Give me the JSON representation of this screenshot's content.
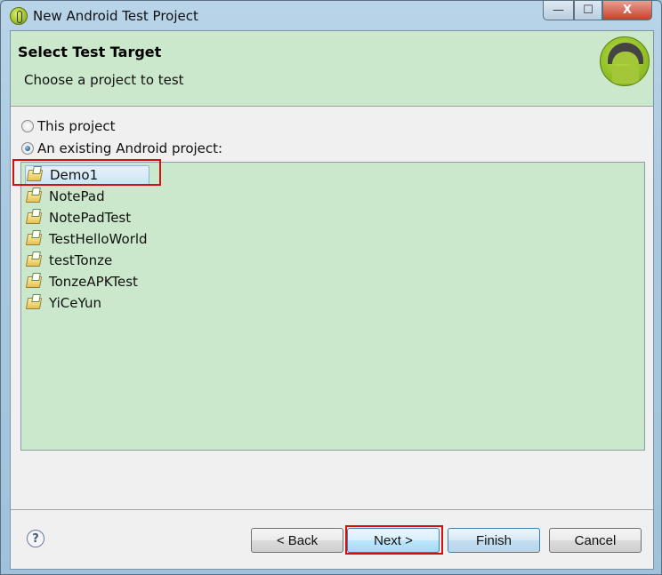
{
  "window": {
    "title": "New Android Test Project",
    "controls": {
      "minimize": "—",
      "maximize": "☐",
      "close": "X"
    }
  },
  "header": {
    "title": "Select Test Target",
    "description": "Choose a project to test"
  },
  "options": {
    "this_project": {
      "label": "This project",
      "selected": false
    },
    "existing_project": {
      "label": "An existing Android project:",
      "selected": true
    }
  },
  "projects": [
    "Demo1",
    "NotePad",
    "NotePadTest",
    "TestHelloWorld",
    "testTonze",
    "TonzeAPKTest",
    "YiCeYun"
  ],
  "selected_project": "Demo1",
  "buttons": {
    "help": "?",
    "back": "< Back",
    "next": "Next >",
    "finish": "Finish",
    "cancel": "Cancel"
  },
  "highlight_color": "#d21010"
}
